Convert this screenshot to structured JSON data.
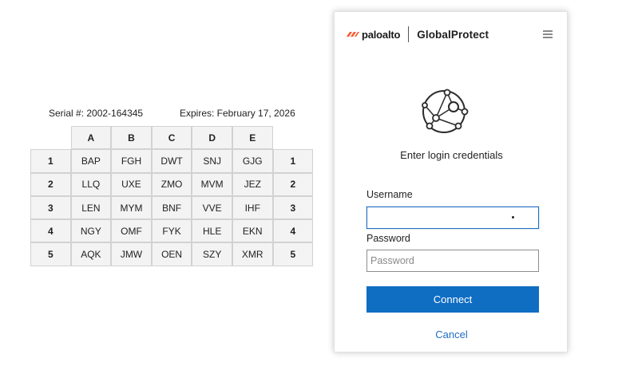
{
  "grid_card": {
    "serial": "Serial #: 2002-164345",
    "expires": "Expires: February 17, 2026",
    "columns": [
      "A",
      "B",
      "C",
      "D",
      "E"
    ],
    "rows": [
      {
        "label": "1",
        "cells": [
          "BAP",
          "FGH",
          "DWT",
          "SNJ",
          "GJG"
        ]
      },
      {
        "label": "2",
        "cells": [
          "LLQ",
          "UXE",
          "ZMO",
          "MVM",
          "JEZ"
        ]
      },
      {
        "label": "3",
        "cells": [
          "LEN",
          "MYM",
          "BNF",
          "VVE",
          "IHF"
        ]
      },
      {
        "label": "4",
        "cells": [
          "NGY",
          "OMF",
          "FYK",
          "HLE",
          "EKN"
        ]
      },
      {
        "label": "5",
        "cells": [
          "AQK",
          "JMW",
          "OEN",
          "SZY",
          "XMR"
        ]
      }
    ]
  },
  "login": {
    "brand_logo": "paloalto",
    "product_name": "GlobalProtect",
    "menu_icon": "hamburger-menu-icon",
    "globe_icon": "network-globe-icon",
    "prompt": "Enter login credentials",
    "username_label": "Username",
    "username_value": "",
    "password_label": "Password",
    "password_placeholder": "Password",
    "connect_label": "Connect",
    "cancel_label": "Cancel"
  },
  "colors": {
    "primary_button": "#0f6dc2",
    "link": "#1f6fbf",
    "logo_red": "#fa582d"
  }
}
